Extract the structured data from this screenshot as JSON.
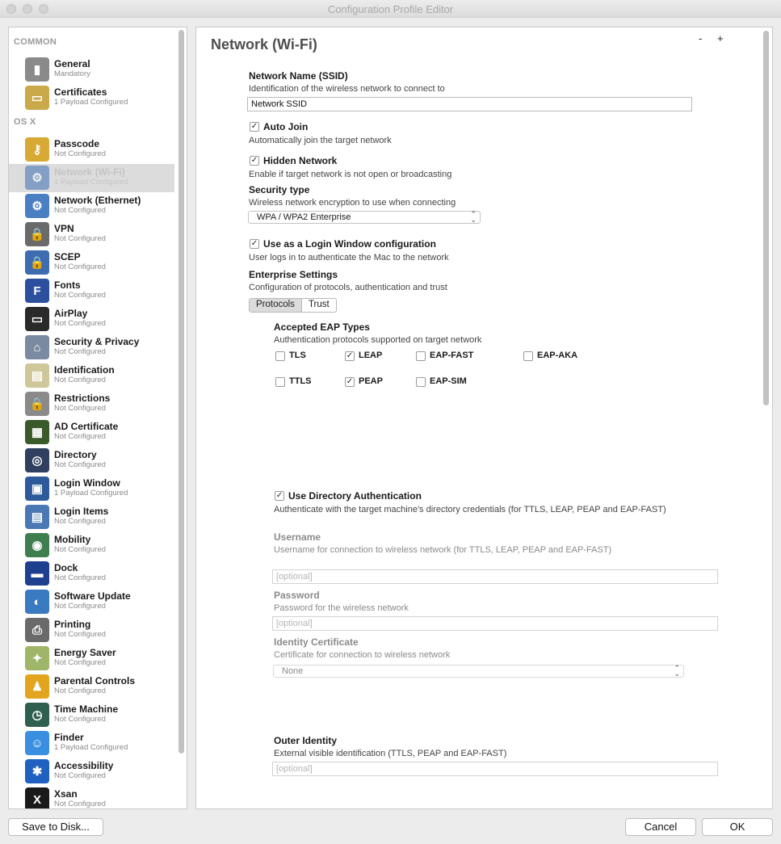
{
  "window": {
    "title": "Configuration Profile Editor"
  },
  "sidebar": {
    "sections": [
      "COMMON",
      "OS X"
    ],
    "items": [
      {
        "title": "General",
        "sub": "Mandatory",
        "icon": "general-icon",
        "color": "#8a8a8a"
      },
      {
        "title": "Certificates",
        "sub": "1 Payload Configured",
        "icon": "certificate-icon",
        "color": "#c9a94a"
      },
      {
        "title": "Passcode",
        "sub": "Not Configured",
        "icon": "key-icon",
        "color": "#d9a935"
      },
      {
        "title": "Network (Wi-Fi)",
        "sub": "1 Payload Configured",
        "icon": "wifi-gear-icon",
        "color": "#3b6fb5"
      },
      {
        "title": "Network (Ethernet)",
        "sub": "Not Configured",
        "icon": "ethernet-gear-icon",
        "color": "#4b7fc4"
      },
      {
        "title": "VPN",
        "sub": "Not Configured",
        "icon": "vpn-lock-icon",
        "color": "#6a6a6a"
      },
      {
        "title": "SCEP",
        "sub": "Not Configured",
        "icon": "scep-lock-icon",
        "color": "#3d6cb0"
      },
      {
        "title": "Fonts",
        "sub": "Not Configured",
        "icon": "font-icon",
        "color": "#2c4f9e"
      },
      {
        "title": "AirPlay",
        "sub": "Not Configured",
        "icon": "airplay-icon",
        "color": "#2a2a2a"
      },
      {
        "title": "Security & Privacy",
        "sub": "Not Configured",
        "icon": "house-lock-icon",
        "color": "#7a8aa0"
      },
      {
        "title": "Identification",
        "sub": "Not Configured",
        "icon": "id-card-icon",
        "color": "#cfc79a"
      },
      {
        "title": "Restrictions",
        "sub": "Not Configured",
        "icon": "restrictions-lock-icon",
        "color": "#8a8a8a"
      },
      {
        "title": "AD Certificate",
        "sub": "Not Configured",
        "icon": "ad-certificate-icon",
        "color": "#3a5a2a"
      },
      {
        "title": "Directory",
        "sub": "Not Configured",
        "icon": "directory-icon",
        "color": "#2f3f5f"
      },
      {
        "title": "Login Window",
        "sub": "1 Payload Configured",
        "icon": "login-window-icon",
        "color": "#2d5a9a"
      },
      {
        "title": "Login Items",
        "sub": "Not Configured",
        "icon": "login-items-icon",
        "color": "#4a78b5"
      },
      {
        "title": "Mobility",
        "sub": "Not Configured",
        "icon": "globe-person-icon",
        "color": "#3f7f4f"
      },
      {
        "title": "Dock",
        "sub": "Not Configured",
        "icon": "dock-icon",
        "color": "#1f3f8f"
      },
      {
        "title": "Software Update",
        "sub": "Not Configured",
        "icon": "software-update-icon",
        "color": "#3a7ac0"
      },
      {
        "title": "Printing",
        "sub": "Not Configured",
        "icon": "printer-icon",
        "color": "#6a6a6a"
      },
      {
        "title": "Energy Saver",
        "sub": "Not Configured",
        "icon": "lightbulb-icon",
        "color": "#9fb56a"
      },
      {
        "title": "Parental Controls",
        "sub": "Not Configured",
        "icon": "parental-controls-icon",
        "color": "#e3a51f"
      },
      {
        "title": "Time Machine",
        "sub": "Not Configured",
        "icon": "time-machine-icon",
        "color": "#2f5f4f"
      },
      {
        "title": "Finder",
        "sub": "1 Payload Configured",
        "icon": "finder-icon",
        "color": "#3b8fe0"
      },
      {
        "title": "Accessibility",
        "sub": "Not Configured",
        "icon": "accessibility-icon",
        "color": "#2060c0"
      },
      {
        "title": "Xsan",
        "sub": "Not Configured",
        "icon": "xsan-icon",
        "color": "#1a1a1a"
      }
    ]
  },
  "main": {
    "title": "Network (Wi-Fi)",
    "minus": "-",
    "plus": "+",
    "ssid": {
      "label": "Network Name (SSID)",
      "desc": "Identification of the wireless network to connect to",
      "value": "Network SSID"
    },
    "auto_join": {
      "label": "Auto Join",
      "desc": "Automatically join the target network",
      "checked": true
    },
    "hidden": {
      "label": "Hidden Network",
      "desc": "Enable if target network is not open or broadcasting",
      "checked": true
    },
    "security": {
      "label": "Security type",
      "desc": "Wireless network encryption to use when connecting",
      "value": "WPA / WPA2 Enterprise"
    },
    "login_window": {
      "label": "Use as a Login Window configuration",
      "desc": "User logs in to authenticate the Mac to the network",
      "checked": true
    },
    "enterprise": {
      "label": "Enterprise Settings",
      "desc": "Configuration of protocols, authentication and trust",
      "tabs": [
        "Protocols",
        "Trust"
      ]
    },
    "eap": {
      "label": "Accepted EAP Types",
      "desc": "Authentication protocols supported on target network",
      "types": [
        {
          "name": "TLS",
          "checked": false
        },
        {
          "name": "LEAP",
          "checked": true
        },
        {
          "name": "EAP-FAST",
          "checked": false
        },
        {
          "name": "EAP-AKA",
          "checked": false
        },
        {
          "name": "TTLS",
          "checked": false
        },
        {
          "name": "PEAP",
          "checked": true
        },
        {
          "name": "EAP-SIM",
          "checked": false
        }
      ]
    },
    "dir_auth": {
      "label": "Use Directory Authentication",
      "desc": "Authenticate with the target machine's directory credentials (for TTLS, LEAP, PEAP and EAP-FAST)",
      "checked": true
    },
    "username": {
      "label": "Username",
      "desc": "Username for connection to wireless network (for TTLS, LEAP, PEAP and EAP-FAST)",
      "placeholder": "[optional]"
    },
    "password": {
      "label": "Password",
      "desc": "Password for the wireless network",
      "placeholder": "[optional]"
    },
    "identity_cert": {
      "label": "Identity Certificate",
      "desc": "Certificate for connection to wireless network",
      "value": "None"
    },
    "outer_identity": {
      "label": "Outer Identity",
      "desc": "External visible identification (TTLS, PEAP and EAP-FAST)",
      "placeholder": "[optional]"
    }
  },
  "footer": {
    "save": "Save to Disk...",
    "cancel": "Cancel",
    "ok": "OK"
  }
}
